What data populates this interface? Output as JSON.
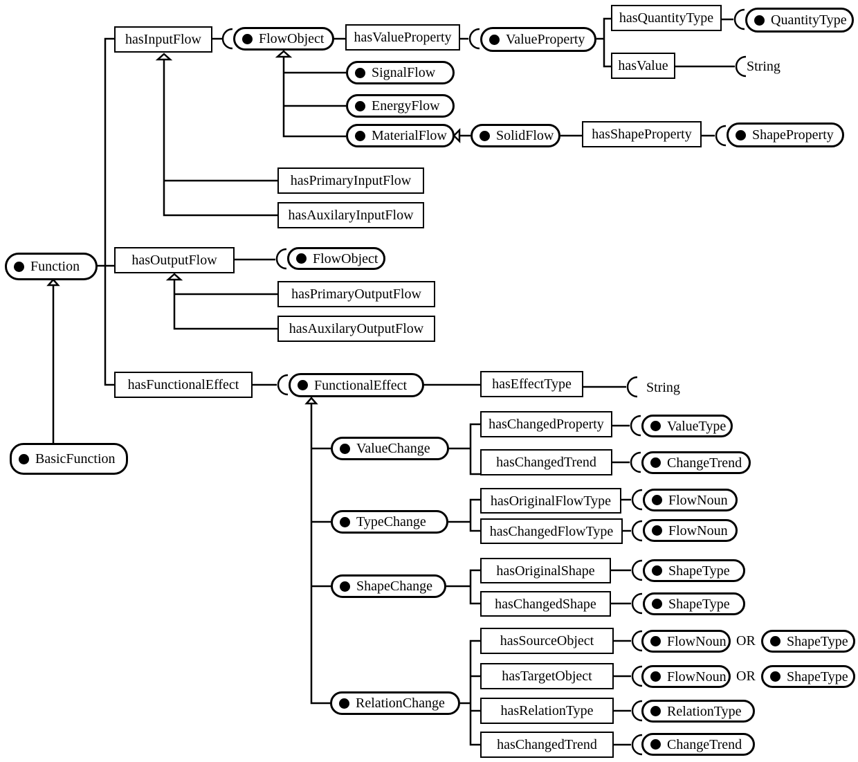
{
  "diagram": {
    "classes": {
      "function": "Function",
      "basic_function": "BasicFunction",
      "flow_object_in": "FlowObject",
      "flow_object_out": "FlowObject",
      "value_property": "ValueProperty",
      "quantity_type": "QuantityType",
      "signal_flow": "SignalFlow",
      "energy_flow": "EnergyFlow",
      "material_flow": "MaterialFlow",
      "solid_flow": "SolidFlow",
      "shape_property": "ShapeProperty",
      "functional_effect": "FunctionalEffect",
      "value_change": "ValueChange",
      "type_change": "TypeChange",
      "shape_change": "ShapeChange",
      "relation_change": "RelationChange",
      "value_type": "ValueType",
      "change_trend_1": "ChangeTrend",
      "flow_noun_1": "FlowNoun",
      "flow_noun_2": "FlowNoun",
      "shape_type_1": "ShapeType",
      "shape_type_2": "ShapeType",
      "flow_noun_3": "FlowNoun",
      "shape_type_3": "ShapeType",
      "flow_noun_4": "FlowNoun",
      "shape_type_4": "ShapeType",
      "relation_type": "RelationType",
      "change_trend_2": "ChangeTrend"
    },
    "properties": {
      "has_input_flow": "hasInputFlow",
      "has_value_property": "hasValueProperty",
      "has_quantity_type": "hasQuantityType",
      "has_value": "hasValue",
      "has_shape_property": "hasShapeProperty",
      "has_primary_input_flow": "hasPrimaryInputFlow",
      "has_auxilary_input_flow": "hasAuxilaryInputFlow",
      "has_output_flow": "hasOutputFlow",
      "has_primary_output_flow": "hasPrimaryOutputFlow",
      "has_auxilary_output_flow": "hasAuxilaryOutputFlow",
      "has_functional_effect": "hasFunctionalEffect",
      "has_effect_type": "hasEffectType",
      "has_changed_property": "hasChangedProperty",
      "has_changed_trend_1": "hasChangedTrend",
      "has_original_flow_type": "hasOriginalFlowType",
      "has_changed_flow_type": "hasChangedFlowType",
      "has_original_shape": "hasOriginalShape",
      "has_changed_shape": "hasChangedShape",
      "has_source_object": "hasSourceObject",
      "has_target_object": "hasTargetObject",
      "has_relation_type": "hasRelationType",
      "has_changed_trend_2": "hasChangedTrend"
    },
    "literals": {
      "string_1": "String",
      "string_2": "String"
    },
    "connectors": {
      "or_1": "OR",
      "or_2": "OR"
    }
  }
}
